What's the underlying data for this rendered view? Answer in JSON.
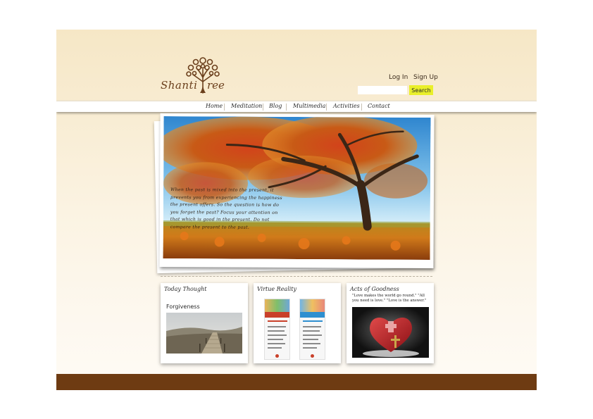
{
  "brand": {
    "name_part1": "Shanti",
    "name_part2": "ree"
  },
  "auth": {
    "login_label": "Log In",
    "signup_label": "Sign Up"
  },
  "search": {
    "placeholder": "",
    "button_label": "Search"
  },
  "nav": {
    "items": [
      {
        "label": "Home"
      },
      {
        "label": "Meditation"
      },
      {
        "label": "Blog"
      },
      {
        "label": "Multimedia"
      },
      {
        "label": "Activities"
      },
      {
        "label": "Contact"
      }
    ]
  },
  "hero": {
    "quote": "When the past is mixed into the present, it prevents you from experiencing the happiness the present offers. So the question is how do you forget the past? Focus your attention on that which is good in the present. Do not compare the present to the past."
  },
  "cards": {
    "today_thought": {
      "title": "Today Thought",
      "subtitle": "Forgiveness"
    },
    "virtue_reality": {
      "title": "Virtue Reality"
    },
    "acts_of_goodness": {
      "title": "Acts of Goodness",
      "quote": "\"Love makes the world go round.\" \"All you need is love.\" \"Love is the answer.\""
    }
  },
  "colors": {
    "accent_search": "#e9ef2a",
    "footer": "#6e3b12",
    "brand_brown": "#6b3f1c"
  },
  "icons": [
    "tree-logo-icon"
  ]
}
